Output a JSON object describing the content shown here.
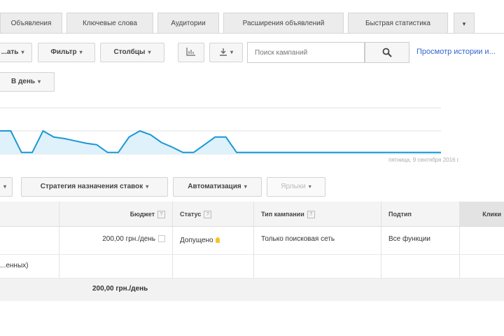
{
  "tabs": [
    "Объявления",
    "Ключевые слова",
    "Аудитории",
    "Расширения объявлений",
    "Быстрая статистика",
    "▾"
  ],
  "toolbar": {
    "edit_label": "...ать",
    "filter_label": "Фильтр",
    "columns_label": "Столбцы",
    "search_placeholder": "Поиск кампаний",
    "history_link": "Просмотр истории и..."
  },
  "period": {
    "label": "В день"
  },
  "chart_caption": "пятница, 9 сентября 2016 г.",
  "chart_data": {
    "type": "area",
    "values": [
      30,
      30,
      2,
      2,
      30,
      22,
      20,
      17,
      14,
      12,
      2,
      2,
      22,
      30,
      25,
      15,
      9,
      2,
      2,
      12,
      22,
      22,
      2,
      2,
      2,
      2,
      2,
      2,
      2,
      2,
      2,
      2,
      2,
      2,
      2,
      2,
      2,
      2,
      2,
      2,
      2,
      2
    ],
    "ylim": [
      0,
      60
    ],
    "grid": true,
    "color": "#1a98d5",
    "fill": "#dff1fa"
  },
  "bulk": {
    "bidding_label": "Стратегия назначения ставок",
    "automation_label": "Автоматизация",
    "labels_label": "Ярлыки"
  },
  "table": {
    "headers": {
      "budget": "Бюджет",
      "status": "Статус",
      "campaign_type": "Тип кампании",
      "subtype": "Подтип",
      "clicks": "Клики"
    },
    "row": {
      "budget": "200,00 грн./день",
      "status": "Допущено",
      "campaign_type": "Только поисковая сеть",
      "subtype": "Все функции"
    },
    "row2_label": "...енных)",
    "total_budget": "200,00 грн./день"
  }
}
